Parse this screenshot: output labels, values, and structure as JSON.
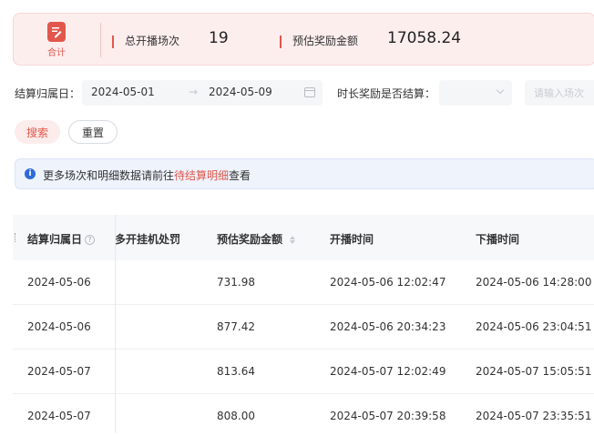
{
  "summary": {
    "badge_label": "合计",
    "stat1_label": "总开播场次",
    "stat1_value": "19",
    "stat2_label": "预估奖励金额",
    "stat2_value": "17058.24"
  },
  "filters": {
    "date_label": "结算归属日：",
    "date_start": "2024-05-01",
    "date_end": "2024-05-09",
    "settled_label": "时长奖励是否结算：",
    "input_placeholder": "请输入场次"
  },
  "buttons": {
    "search": "搜索",
    "reset": "重置"
  },
  "notice": {
    "text_before": "更多场次和明细数据请前往",
    "link": "待结算明细",
    "text_after": "查看"
  },
  "table": {
    "headers": {
      "date": "结算归属日",
      "penalty": "多开挂机处罚",
      "reward": "预估奖励金额",
      "start": "开播时间",
      "end": "下播时间"
    },
    "rows": [
      {
        "date": "2024-05-06",
        "reward": "731.98",
        "start": "2024-05-06 12:02:47",
        "end": "2024-05-06 14:28:00"
      },
      {
        "date": "2024-05-06",
        "reward": "877.42",
        "start": "2024-05-06 20:34:23",
        "end": "2024-05-06 23:04:51"
      },
      {
        "date": "2024-05-07",
        "reward": "813.64",
        "start": "2024-05-07 12:02:49",
        "end": "2024-05-07 15:05:51"
      },
      {
        "date": "2024-05-07",
        "reward": "808.00",
        "start": "2024-05-07 20:39:58",
        "end": "2024-05-07 23:35:51"
      }
    ]
  },
  "colors": {
    "accent": "#e2574c",
    "info": "#2f6bd8"
  }
}
